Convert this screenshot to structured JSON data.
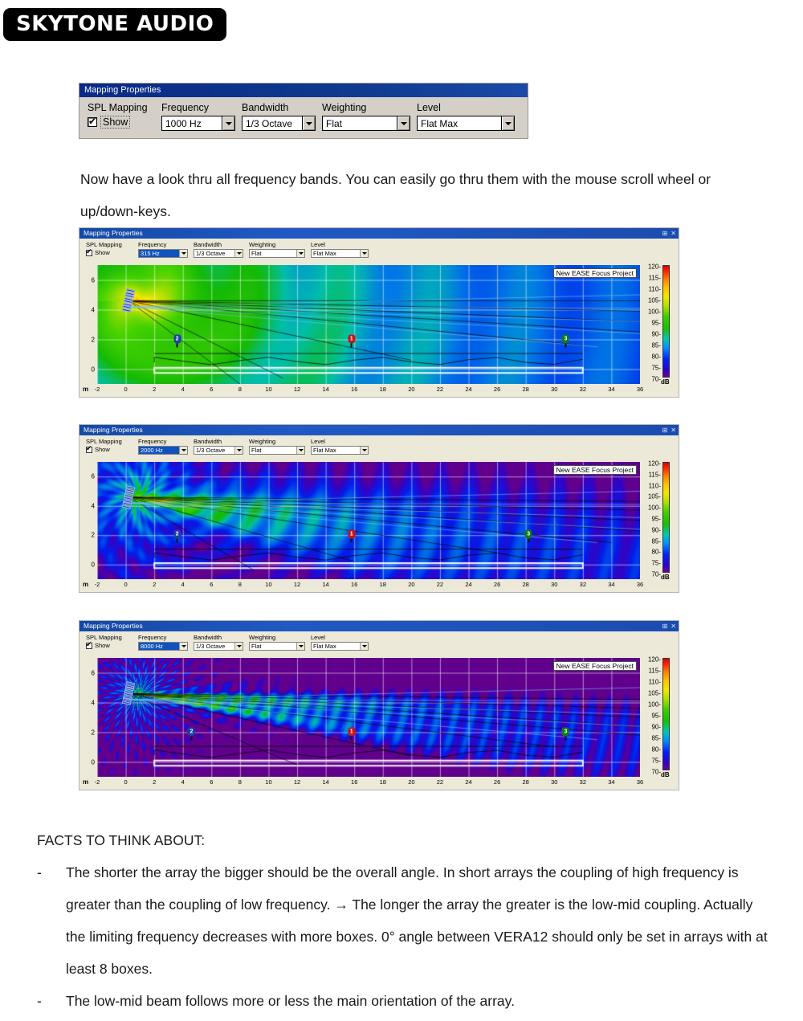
{
  "brand": {
    "name": "SKYTONE AUDIO"
  },
  "mapping_properties_panel": {
    "title": "Mapping Properties",
    "pin_icon": "pin-icon",
    "close_icon": "close-icon",
    "fields": {
      "spl_mapping_label": "SPL Mapping",
      "show_label": "Show",
      "show_checked": true,
      "frequency_label": "Frequency",
      "frequency_value": "1000 Hz",
      "bandwidth_label": "Bandwidth",
      "bandwidth_value": "1/3 Octave",
      "weighting_label": "Weighting",
      "weighting_value": "Flat",
      "level_label": "Level",
      "level_value": "Flat Max"
    }
  },
  "intro_paragraph": "Now have a look thru all frequency bands. You can easily go thru them with the mouse scroll wheel or up/down-keys.",
  "maps": [
    {
      "window_title": "Mapping Properties",
      "toolbar": {
        "spl_mapping_label": "SPL Mapping",
        "show_label": "Show",
        "frequency_label": "Frequency",
        "frequency_value": "315 Hz",
        "bandwidth_label": "Bandwidth",
        "bandwidth_value": "1/3 Octave",
        "weighting_label": "Weighting",
        "weighting_value": "Flat",
        "level_label": "Level",
        "level_value": "Flat Max"
      },
      "project_label": "New EASE Focus Project",
      "markers": [
        {
          "id": "2",
          "color": "#1b3fa8",
          "x": 3.6,
          "y": 2.0
        },
        {
          "id": "1",
          "color": "#c81414",
          "x": 15.8,
          "y": 2.0
        },
        {
          "id": "3",
          "color": "#0f7a18",
          "x": 30.8,
          "y": 2.0
        }
      ]
    },
    {
      "window_title": "Mapping Properties",
      "toolbar": {
        "spl_mapping_label": "SPL Mapping",
        "show_label": "Show",
        "frequency_label": "Frequency",
        "frequency_value": "2000 Hz",
        "bandwidth_label": "Bandwidth",
        "bandwidth_value": "1/3 Octave",
        "weighting_label": "Weighting",
        "weighting_value": "Flat",
        "level_label": "Level",
        "level_value": "Flat Max"
      },
      "project_label": "New EASE Focus Project",
      "markers": [
        {
          "id": "2",
          "color": "#1b3fa8",
          "x": 3.6,
          "y": 2.0
        },
        {
          "id": "1",
          "color": "#c81414",
          "x": 15.8,
          "y": 2.0
        },
        {
          "id": "3",
          "color": "#0f7a18",
          "x": 28.2,
          "y": 2.0
        }
      ]
    },
    {
      "window_title": "Mapping Properties",
      "toolbar": {
        "spl_mapping_label": "SPL Mapping",
        "show_label": "Show",
        "frequency_label": "Frequency",
        "frequency_value": "8000 Hz",
        "bandwidth_label": "Bandwidth",
        "bandwidth_value": "1/3 Octave",
        "weighting_label": "Weighting",
        "weighting_value": "Flat",
        "level_label": "Level",
        "level_value": "Flat Max"
      },
      "project_label": "New EASE Focus Project",
      "markers": [
        {
          "id": "2",
          "color": "#1b3fa8",
          "x": 4.6,
          "y": 2.0
        },
        {
          "id": "1",
          "color": "#c81414",
          "x": 15.8,
          "y": 2.0
        },
        {
          "id": "3",
          "color": "#0f7a18",
          "x": 30.8,
          "y": 2.0
        }
      ]
    }
  ],
  "chart_data": {
    "type": "heatmap",
    "title": "New EASE Focus Project",
    "xlabel": "m",
    "ylabel": "m",
    "xlim": [
      -2,
      36
    ],
    "ylim": [
      -1,
      7
    ],
    "xticks": [
      -2,
      0,
      2,
      4,
      6,
      8,
      10,
      12,
      14,
      16,
      18,
      20,
      22,
      24,
      26,
      28,
      30,
      32,
      34,
      36
    ],
    "yticks": [
      0,
      2,
      4,
      6
    ],
    "grid": true,
    "legend_position": "right",
    "colorbar": {
      "unit": "dB",
      "min": 70,
      "max": 120,
      "step": 5,
      "ticks": [
        120,
        115,
        110,
        105,
        100,
        95,
        90,
        85,
        80,
        75,
        70
      ]
    },
    "series": [
      {
        "name": "315 Hz 1/3 Octave Flat Max SPL map",
        "frequency_hz": 315
      },
      {
        "name": "2000 Hz 1/3 Octave Flat Max SPL map",
        "frequency_hz": 2000
      },
      {
        "name": "8000 Hz 1/3 Octave Flat Max SPL map",
        "frequency_hz": 8000
      }
    ],
    "receiver_points": [
      {
        "id": "1",
        "x": 15.8,
        "y": 2.0
      },
      {
        "id": "2",
        "x": 3.6,
        "y": 2.0
      },
      {
        "id": "3",
        "x": 30.8,
        "y": 2.0
      }
    ],
    "source_array": {
      "x": 0.2,
      "y": 4.6,
      "boxes": 8
    }
  },
  "facts": {
    "heading": "FACTS TO THINK ABOUT:",
    "bullet_marker": "-",
    "items": [
      "The shorter the array the bigger should be the overall angle. In short arrays the coupling of high frequency is greater than the coupling of low frequency. → The longer the array the greater is the low-mid coupling. Actually the limiting frequency decreases with more boxes. 0° angle between VERA12 should only be set in arrays with at least 8 boxes.",
      "The low-mid beam follows more or less the main orientation of the array."
    ]
  }
}
